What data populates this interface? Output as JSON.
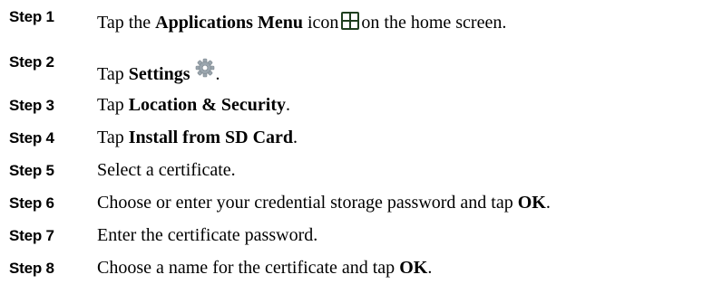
{
  "icons": {
    "applications_menu": "applications-menu-icon",
    "settings": "settings-gear-icon"
  },
  "colors": {
    "text": "#000000",
    "apps_icon_bg": "#1f3f1f",
    "gear": "#9aa5ad"
  },
  "steps": [
    {
      "number": "Step 1",
      "parts": [
        "Tap the ",
        "Applications Menu",
        " icon",
        "on the home screen."
      ]
    },
    {
      "number": "Step 2",
      "parts": [
        "Tap ",
        "Settings",
        "."
      ]
    },
    {
      "number": "Step 3",
      "parts": [
        "Tap ",
        "Location & Security",
        "."
      ]
    },
    {
      "number": "Step 4",
      "parts": [
        "Tap ",
        "Install from SD Card",
        "."
      ]
    },
    {
      "number": "Step 5",
      "parts": [
        "Select a certificate."
      ]
    },
    {
      "number": "Step 6",
      "parts": [
        "Choose or enter your credential storage password and tap ",
        "OK",
        "."
      ]
    },
    {
      "number": "Step 7",
      "parts": [
        "Enter the certificate password."
      ]
    },
    {
      "number": "Step 8",
      "parts": [
        "Choose a name for the certificate and tap ",
        "OK",
        "."
      ]
    }
  ]
}
